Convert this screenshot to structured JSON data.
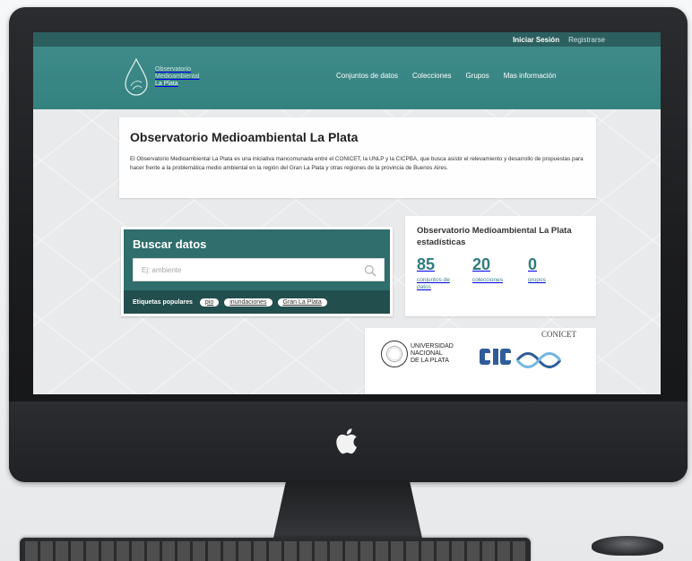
{
  "topbar": {
    "login_label": "Iniciar Sesión",
    "register_label": "Registrarse"
  },
  "logo": {
    "line1": "Observatorio",
    "line2": "Medioambiental",
    "line3": "La Plata",
    "icon": "water-drop-icon"
  },
  "nav": {
    "items": [
      "Conjuntos de datos",
      "Colecciones",
      "Grupos",
      "Mas información"
    ]
  },
  "intro": {
    "title": "Observatorio Medioambiental La Plata",
    "text": "El Observatorio Medioambiental La Plata es una iniciativa mancomunada entre el CONICET, la UNLP y la CICPBA, que busca asistir el relevamiento y desarrollo de propuestas para hacer frente a la problemática medio ambiental en la región del Gran La Plata y otras regiones de la provincia de Buenos Aires."
  },
  "search": {
    "title": "Buscar datos",
    "placeholder": "Ej: ambiente",
    "tags_label": "Etiquetas populares",
    "tags": [
      "pio",
      "inundaciones",
      "Gran La Plata"
    ]
  },
  "stats": {
    "title": "Observatorio Medioambiental La Plata estadísticas",
    "items": [
      {
        "value": "85",
        "label": "conjuntos de datos"
      },
      {
        "value": "20",
        "label": "colecciones"
      },
      {
        "value": "0",
        "label": "grupos"
      }
    ]
  },
  "logos": {
    "unlp_line1": "UNIVERSIDAD",
    "unlp_line2": "NACIONAL",
    "unlp_line3": "DE LA PLATA",
    "conicet_label": "CONICET"
  },
  "colors": {
    "topbar": "#2c5f60",
    "masthead": "#3e8b89",
    "search_card": "#2f6e6c",
    "tags_bar": "#224f4e",
    "stat_accent": "#2f7b7f"
  }
}
